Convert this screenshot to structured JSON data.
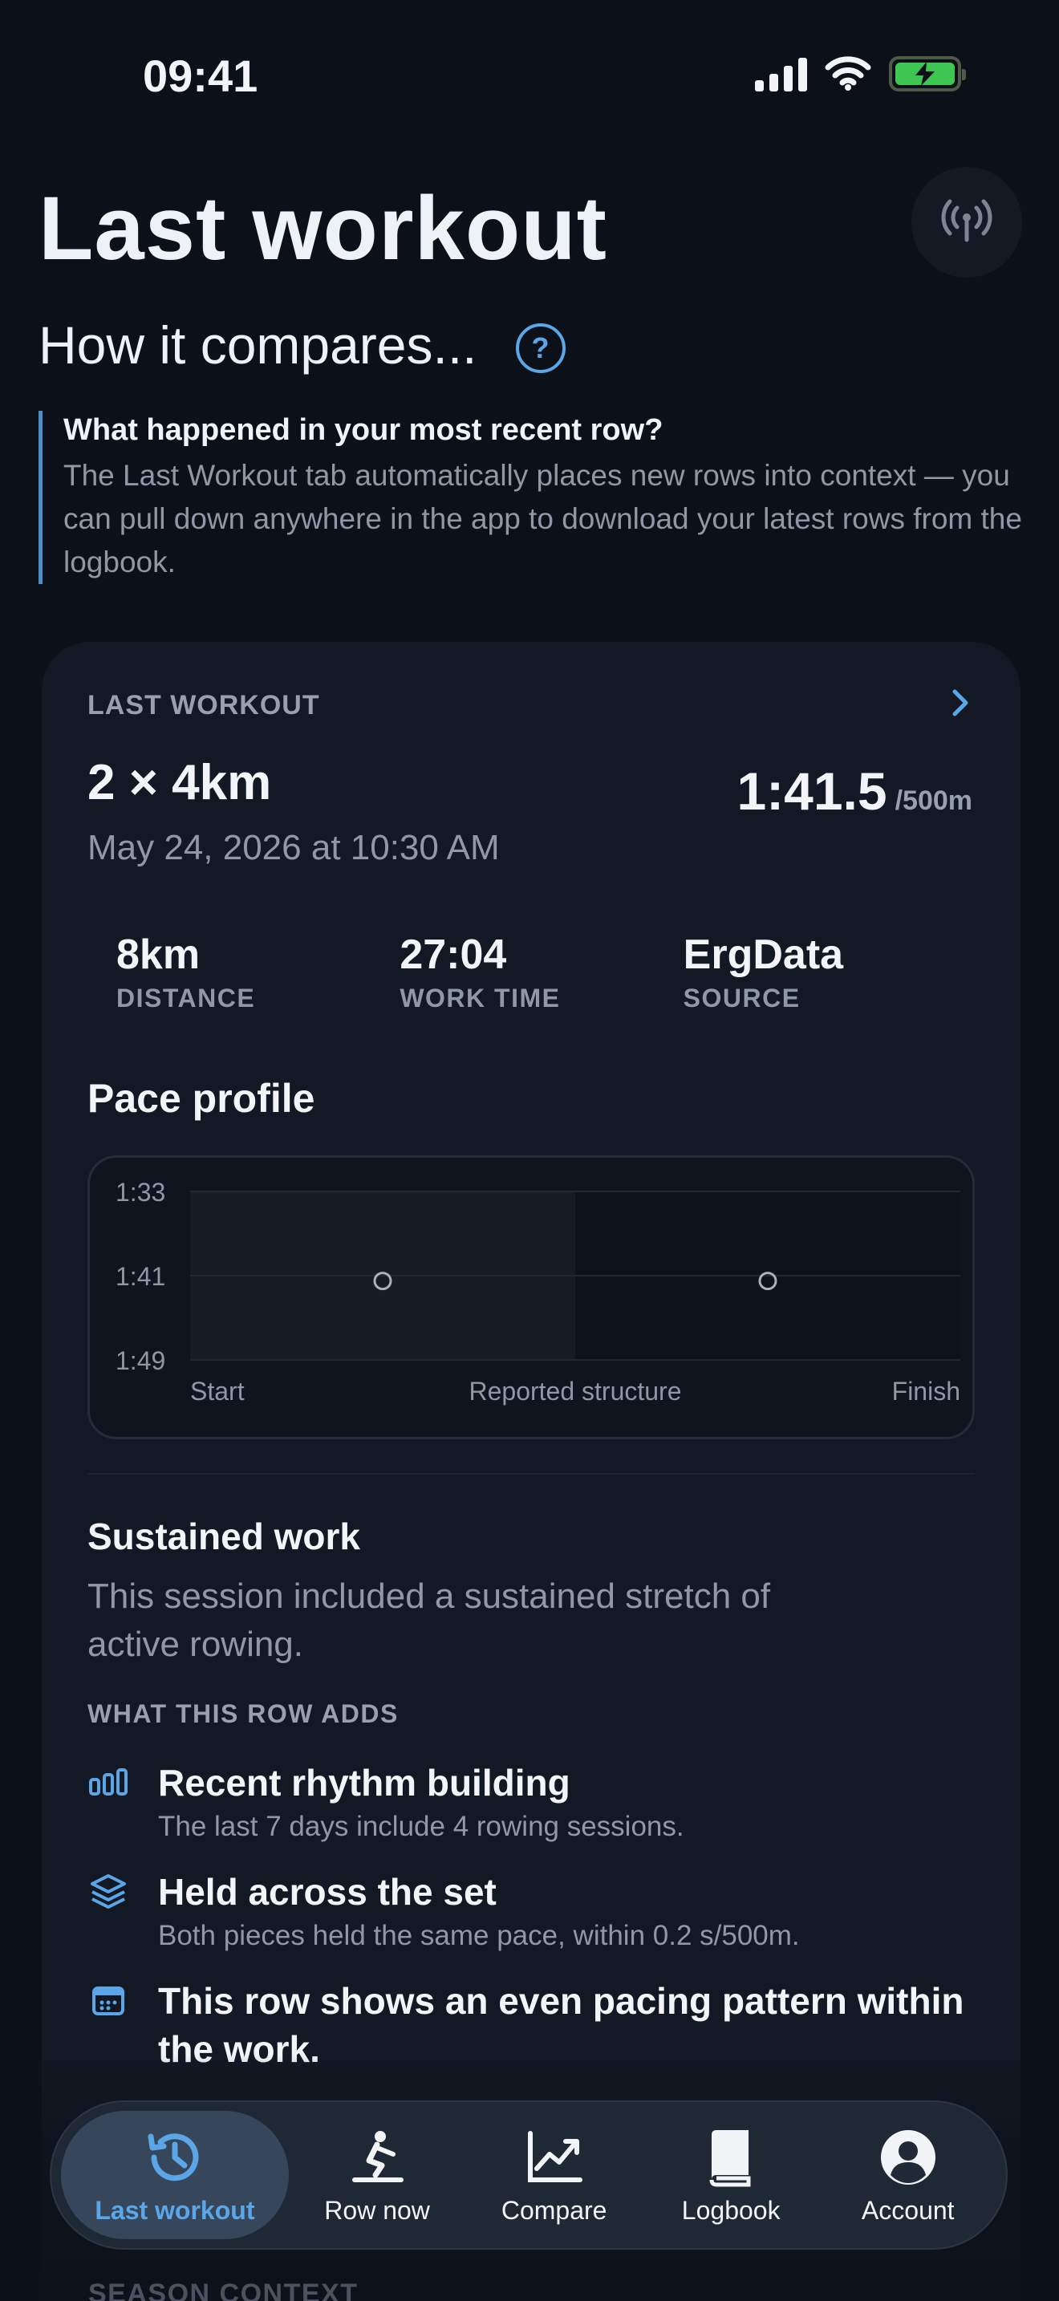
{
  "status": {
    "time": "09:41"
  },
  "header": {
    "title": "Last workout",
    "subtitle": "How it compares...",
    "help_label": "?"
  },
  "info": {
    "question": "What happened in your most recent row?",
    "text": "The Last Workout tab automatically places new rows into context — you can pull down anywhere in the app to download your latest rows from the logbook."
  },
  "card": {
    "label": "LAST WORKOUT",
    "name": "2 × 4km",
    "date": "May 24, 2026 at 10:30 AM",
    "pace": "1:41.5",
    "pace_unit": "/500m",
    "stats": [
      {
        "value": "8km",
        "label": "DISTANCE"
      },
      {
        "value": "27:04",
        "label": "WORK TIME"
      },
      {
        "value": "ErgData",
        "label": "SOURCE"
      }
    ],
    "pace_profile_title": "Pace profile",
    "sustained_title": "Sustained work",
    "sustained_text": "This session included a sustained stretch of active rowing.",
    "adds_label": "WHAT THIS ROW ADDS",
    "adds": [
      {
        "title": "Recent rhythm building",
        "sub": "The last 7 days include 4 rowing sessions.",
        "icon": "bars-icon"
      },
      {
        "title": "Held across the set",
        "sub": "Both pieces held the same pace, within 0.2 s/500m.",
        "icon": "layers-icon"
      },
      {
        "title": "This row shows an even pacing pattern within the work.",
        "sub": "",
        "icon": "calendar-icon"
      }
    ],
    "season_label": "SEASON CONTEXT"
  },
  "chart_data": {
    "type": "scatter",
    "y_ticks": [
      "1:33",
      "1:41",
      "1:49"
    ],
    "x_labels": [
      "Start",
      "Reported structure",
      "Finish"
    ],
    "ylim": [
      "1:33",
      "1:49"
    ],
    "y_inverted": true,
    "segments": 2,
    "points": [
      {
        "segment": 1,
        "pace": "1:41.5"
      },
      {
        "segment": 2,
        "pace": "1:41.5"
      }
    ],
    "grid": true
  },
  "tabs": [
    {
      "label": "Last workout",
      "icon": "history-icon",
      "active": true
    },
    {
      "label": "Row now",
      "icon": "rower-icon",
      "active": false
    },
    {
      "label": "Compare",
      "icon": "chart-icon",
      "active": false
    },
    {
      "label": "Logbook",
      "icon": "book-icon",
      "active": false
    },
    {
      "label": "Account",
      "icon": "person-icon",
      "active": false
    }
  ],
  "colors": {
    "accent": "#5aa6e6",
    "background": "#0c1119",
    "card": "#121924",
    "battery": "#3ec653"
  }
}
